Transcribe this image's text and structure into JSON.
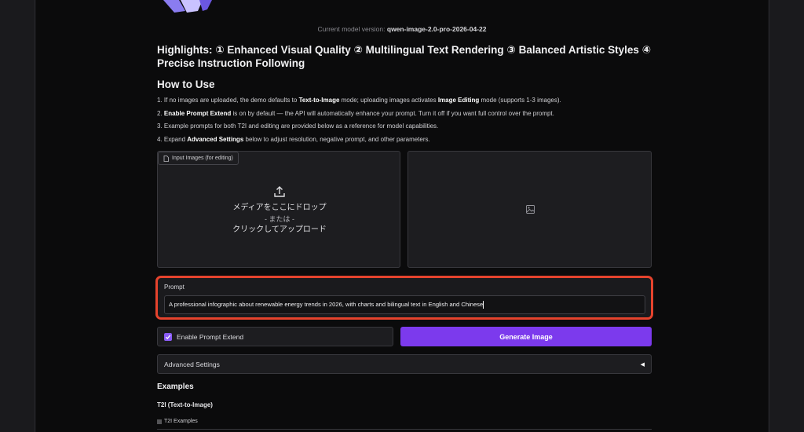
{
  "header": {
    "version_prefix": "Current model version:",
    "version_value": "qwen-image-2.0-pro-2026-04-22"
  },
  "highlights": "Highlights: ① Enhanced Visual Quality ② Multilingual Text Rendering ③ Balanced Artistic Styles ④ Precise Instruction Following",
  "how_to_use": {
    "heading": "How to Use",
    "steps": [
      {
        "a": "1. If no images are uploaded, the demo defaults to ",
        "b1": "Text-to-Image",
        "c": " mode; uploading images activates ",
        "b2": "Image Editing",
        "d": " mode (supports 1-3 images)."
      },
      {
        "a": "2. ",
        "b1": "Enable Prompt Extend",
        "c": " is on by default — the API will automatically enhance your prompt. Turn it off if you want full control over the prompt."
      },
      {
        "a": "3. Example prompts for both T2I and editing are provided below as a reference for model capabilities."
      },
      {
        "a": "4. Expand ",
        "b1": "Advanced Settings",
        "c": " below to adjust resolution, negative prompt, and other parameters."
      }
    ]
  },
  "input_images": {
    "label": "Input Images (for editing)",
    "drop_text": "メディアをここにドロップ",
    "or_text": "- または -",
    "click_text": "クリックしてアップロード"
  },
  "prompt": {
    "label": "Prompt",
    "value": "A professional infographic about renewable energy trends in 2026, with charts and bilingual text in English and Chinese"
  },
  "extend": {
    "label": "Enable Prompt Extend",
    "checked": true
  },
  "generate_label": "Generate Image",
  "advanced_label": "Advanced Settings",
  "advanced_arrow": "◀",
  "examples": {
    "heading": "Examples",
    "t2i_heading": "T2I (Text-to-Image)",
    "t2i_tab": "T2I Examples"
  },
  "colors": {
    "accent": "#7c3aed",
    "highlight_border": "#e5432d",
    "background": "#0b0b0c"
  }
}
